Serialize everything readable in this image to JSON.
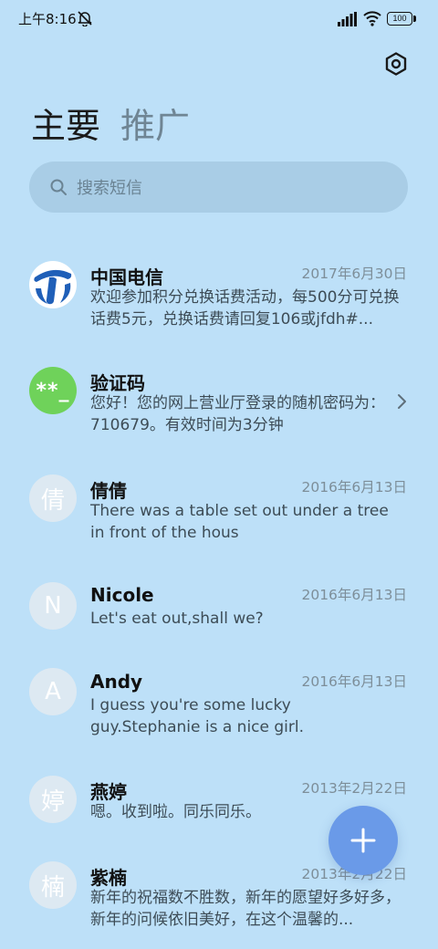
{
  "status_bar": {
    "time": "上午8:16",
    "battery": "100",
    "icons": [
      "mute-icon",
      "signal-icon",
      "wifi-icon",
      "battery-icon"
    ]
  },
  "header": {
    "settings_icon": "settings-icon"
  },
  "tabs": [
    {
      "label": "主要",
      "active": true
    },
    {
      "label": "推广",
      "active": false
    }
  ],
  "search": {
    "placeholder": "搜索短信",
    "icon": "search-icon"
  },
  "conversations": [
    {
      "name": "中国电信",
      "date": "2017年6月30日",
      "snippet": "欢迎参加积分兑换话费活动，每500分可兑换话费5元，兑换话费请回复106或jfdh#...",
      "avatar": "china-telecom-logo"
    },
    {
      "name": "验证码",
      "date": "",
      "snippet": "您好！您的网上营业厅登录的随机密码为：710679。有效时间为3分钟",
      "avatar_text": "**_",
      "icon": "chevron-right-icon"
    },
    {
      "name": "倩倩",
      "date": "2016年6月13日",
      "snippet": "There was a table set out under a tree in front of the hous",
      "avatar_text": "倩"
    },
    {
      "name": "Nicole",
      "date": "2016年6月13日",
      "snippet": "Let's eat out,shall we?",
      "avatar_text": "N"
    },
    {
      "name": "Andy",
      "date": "2016年6月13日",
      "snippet": "I guess you're some lucky guy.Stephanie is a nice girl.",
      "avatar_text": "A"
    },
    {
      "name": "燕婷",
      "date": "2013年2月22日",
      "snippet": "嗯。收到啦。同乐同乐。",
      "avatar_text": "婷"
    },
    {
      "name": "紫楠",
      "date": "2013年2月22日",
      "snippet": "新年的祝福数不胜数，新年的愿望好多好多，新年的问候依旧美好，在这个温馨的...",
      "avatar_text": "楠"
    }
  ],
  "fab": {
    "icon": "plus-icon"
  },
  "colors": {
    "background": "#bde0f8",
    "search_bg": "#a9cde6",
    "fab": "#6a9ae8",
    "code_avatar": "#6fd25a",
    "brand_blue": "#1f5fb8"
  }
}
